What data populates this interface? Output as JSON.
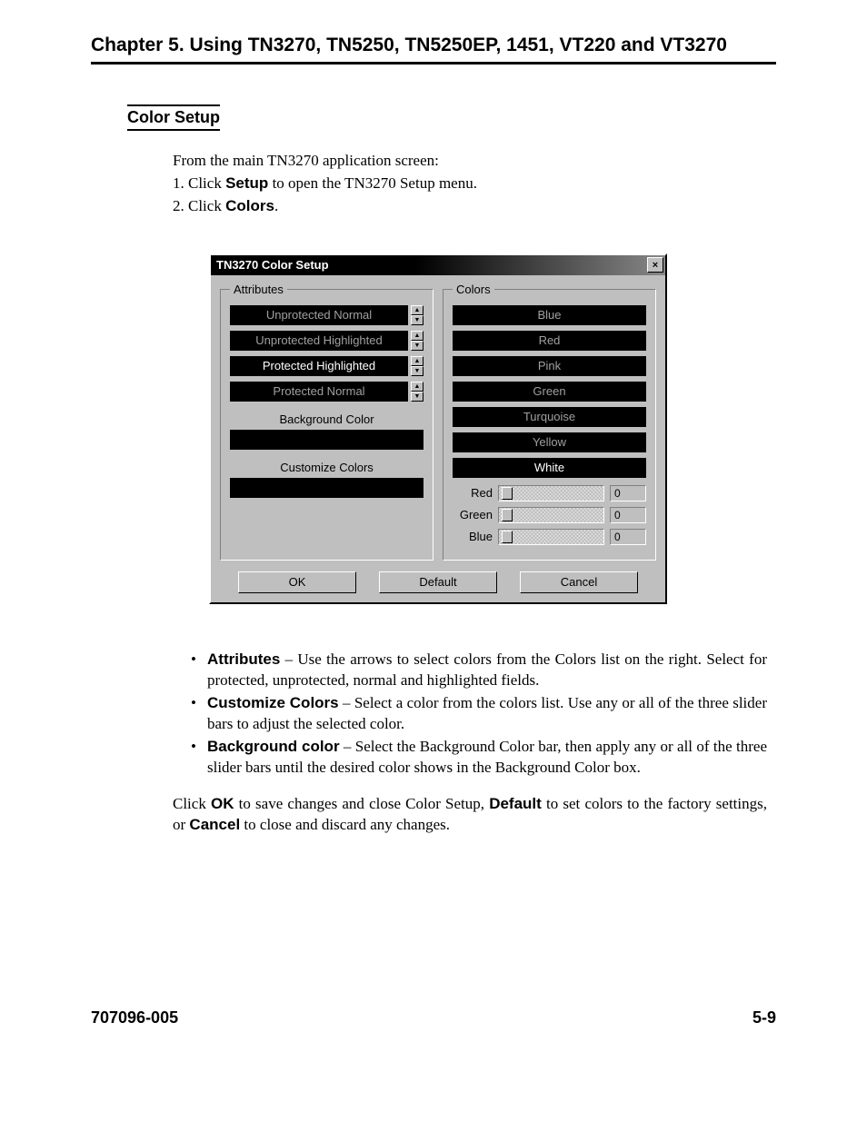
{
  "chapter_title": "Chapter 5.  Using  TN3270, TN5250, TN5250EP, 1451, VT220 and VT3270",
  "section_heading": "Color Setup",
  "intro": {
    "lead": "From the main TN3270 application screen:",
    "step1_pre": "1. Click ",
    "step1_bold": "Setup",
    "step1_post": " to open the TN3270 Setup menu.",
    "step2_pre": "2. Click ",
    "step2_bold": "Colors",
    "step2_post": "."
  },
  "dialog": {
    "title": "TN3270 Color Setup",
    "close_label": "×",
    "group_attributes": "Attributes",
    "group_colors": "Colors",
    "attr_items": [
      "Unprotected Normal",
      "Unprotected Highlighted",
      "Protected Highlighted",
      "Protected Normal"
    ],
    "bg_label": "Background Color",
    "customize_label": "Customize Colors",
    "color_items": [
      "Blue",
      "Red",
      "Pink",
      "Green",
      "Turquoise",
      "Yellow",
      "White"
    ],
    "sliders": [
      {
        "label": "Red",
        "value": "0"
      },
      {
        "label": "Green",
        "value": "0"
      },
      {
        "label": "Blue",
        "value": "0"
      }
    ],
    "buttons": {
      "ok": "OK",
      "def": "Default",
      "cancel": "Cancel"
    }
  },
  "bullets": [
    {
      "bold": "Attributes",
      "text": " – Use the arrows to select colors from the Colors list on the right. Select for protected, unprotected, normal and highlighted fields."
    },
    {
      "bold": "Customize Colors",
      "text": " – Select a color from the colors list. Use any or all of the three slider bars to adjust the selected color."
    },
    {
      "bold": "Background color",
      "text": " – Select the Background Color bar, then apply any or all of the three slider bars until the desired color shows in the Background Color box."
    }
  ],
  "closing": {
    "p1": "Click ",
    "b1": "OK",
    "p2": " to save changes and close Color Setup, ",
    "b2": "Default",
    "p3": " to set colors to the factory settings, or ",
    "b3": "Cancel",
    "p4": " to close and discard any changes."
  },
  "footer": {
    "left": "707096-005",
    "right": "5-9"
  }
}
